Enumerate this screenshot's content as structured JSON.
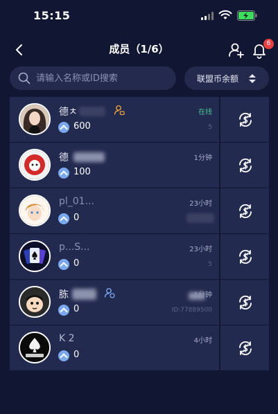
{
  "status_bar": {
    "time": "15:15"
  },
  "header": {
    "title": "成员（1/6）",
    "notification_count": "6"
  },
  "search": {
    "placeholder": "请输入名称或ID搜索",
    "sort_label": "联盟币余额"
  },
  "members": [
    {
      "name": "德ㅊ",
      "role": "admin",
      "amount": "600",
      "status": "在线",
      "uid": "5"
    },
    {
      "name": "德",
      "role": "",
      "amount": "100",
      "status": "1分钟",
      "uid": ""
    },
    {
      "name": "pl_01...",
      "role": "",
      "amount": "0",
      "status": "23小时",
      "uid": ""
    },
    {
      "name": "p...S...",
      "role": "",
      "amount": "0",
      "status": "23小时",
      "uid": "5"
    },
    {
      "name": "胨",
      "role": "manager",
      "amount": "0",
      "status": "1分钟",
      "uid": "ID:77889500"
    },
    {
      "name": "K 2",
      "role": "",
      "amount": "0",
      "status": "4小时",
      "uid": ""
    }
  ],
  "colors": {
    "background": "#111633",
    "row": "#232a4f",
    "online": "#48c18e",
    "coin": "#7aa8ef",
    "badge": "#e94040"
  }
}
